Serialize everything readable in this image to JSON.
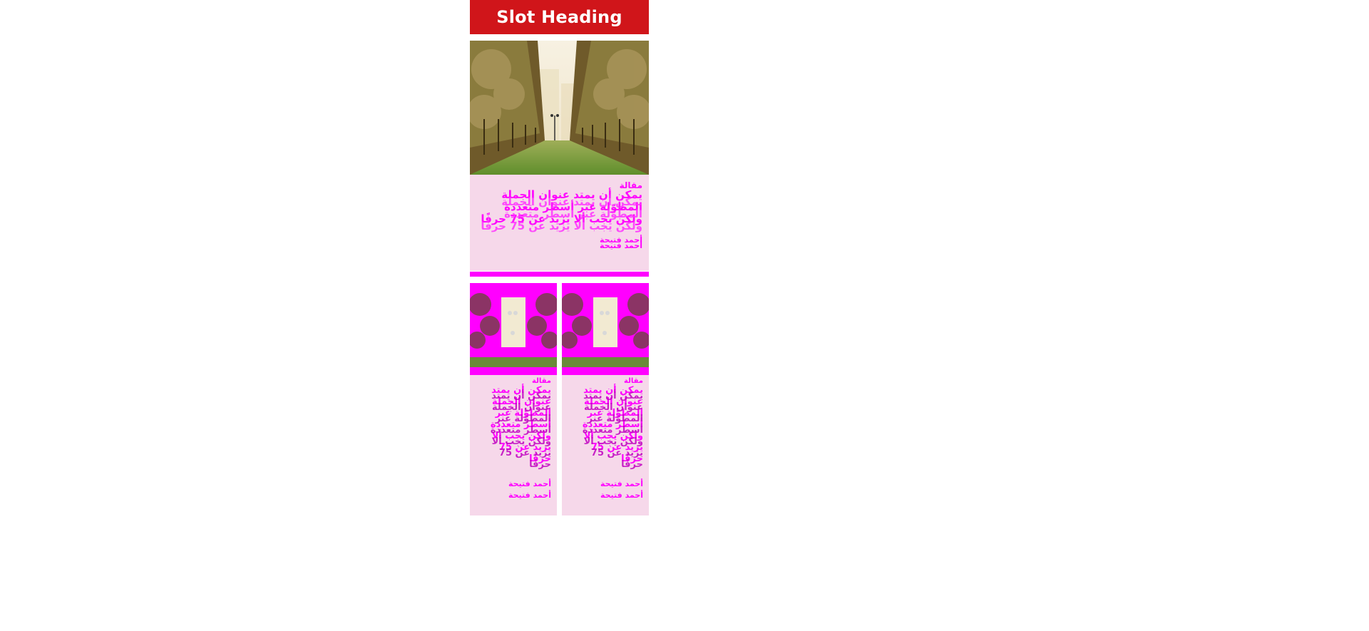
{
  "slot": {
    "heading": "Slot Heading"
  },
  "hero": {
    "image_alt": "palm tree avenue",
    "tag": "مقالة",
    "title": "يمكن أن يمتد عنوان الجملة المطوّلة عبر أسطر متعددة ولكن يجب ألا يزيد عن 75 حرفًا",
    "author": "أحمد فتيحة"
  },
  "cards": [
    {
      "tag": "مقالة",
      "title": "يمكن أن يمتد عنوان الجملة المطوّلة عبر أسطر متعددة ولكن يجب ألا يزيد عن 75 حرفًا",
      "author": "أحمد فتيحة"
    },
    {
      "tag": "مقالة",
      "title": "يمكن أن يمتد عنوان الجملة المطوّلة عبر أسطر متعددة ولكن يجب ألا يزيد عن 75 حرفًا",
      "author": "أحمد فتيحة"
    }
  ],
  "colors": {
    "heading_bg": "#d0151a",
    "accent": "#ff00ff",
    "card_bg": "#f6d8ea"
  }
}
